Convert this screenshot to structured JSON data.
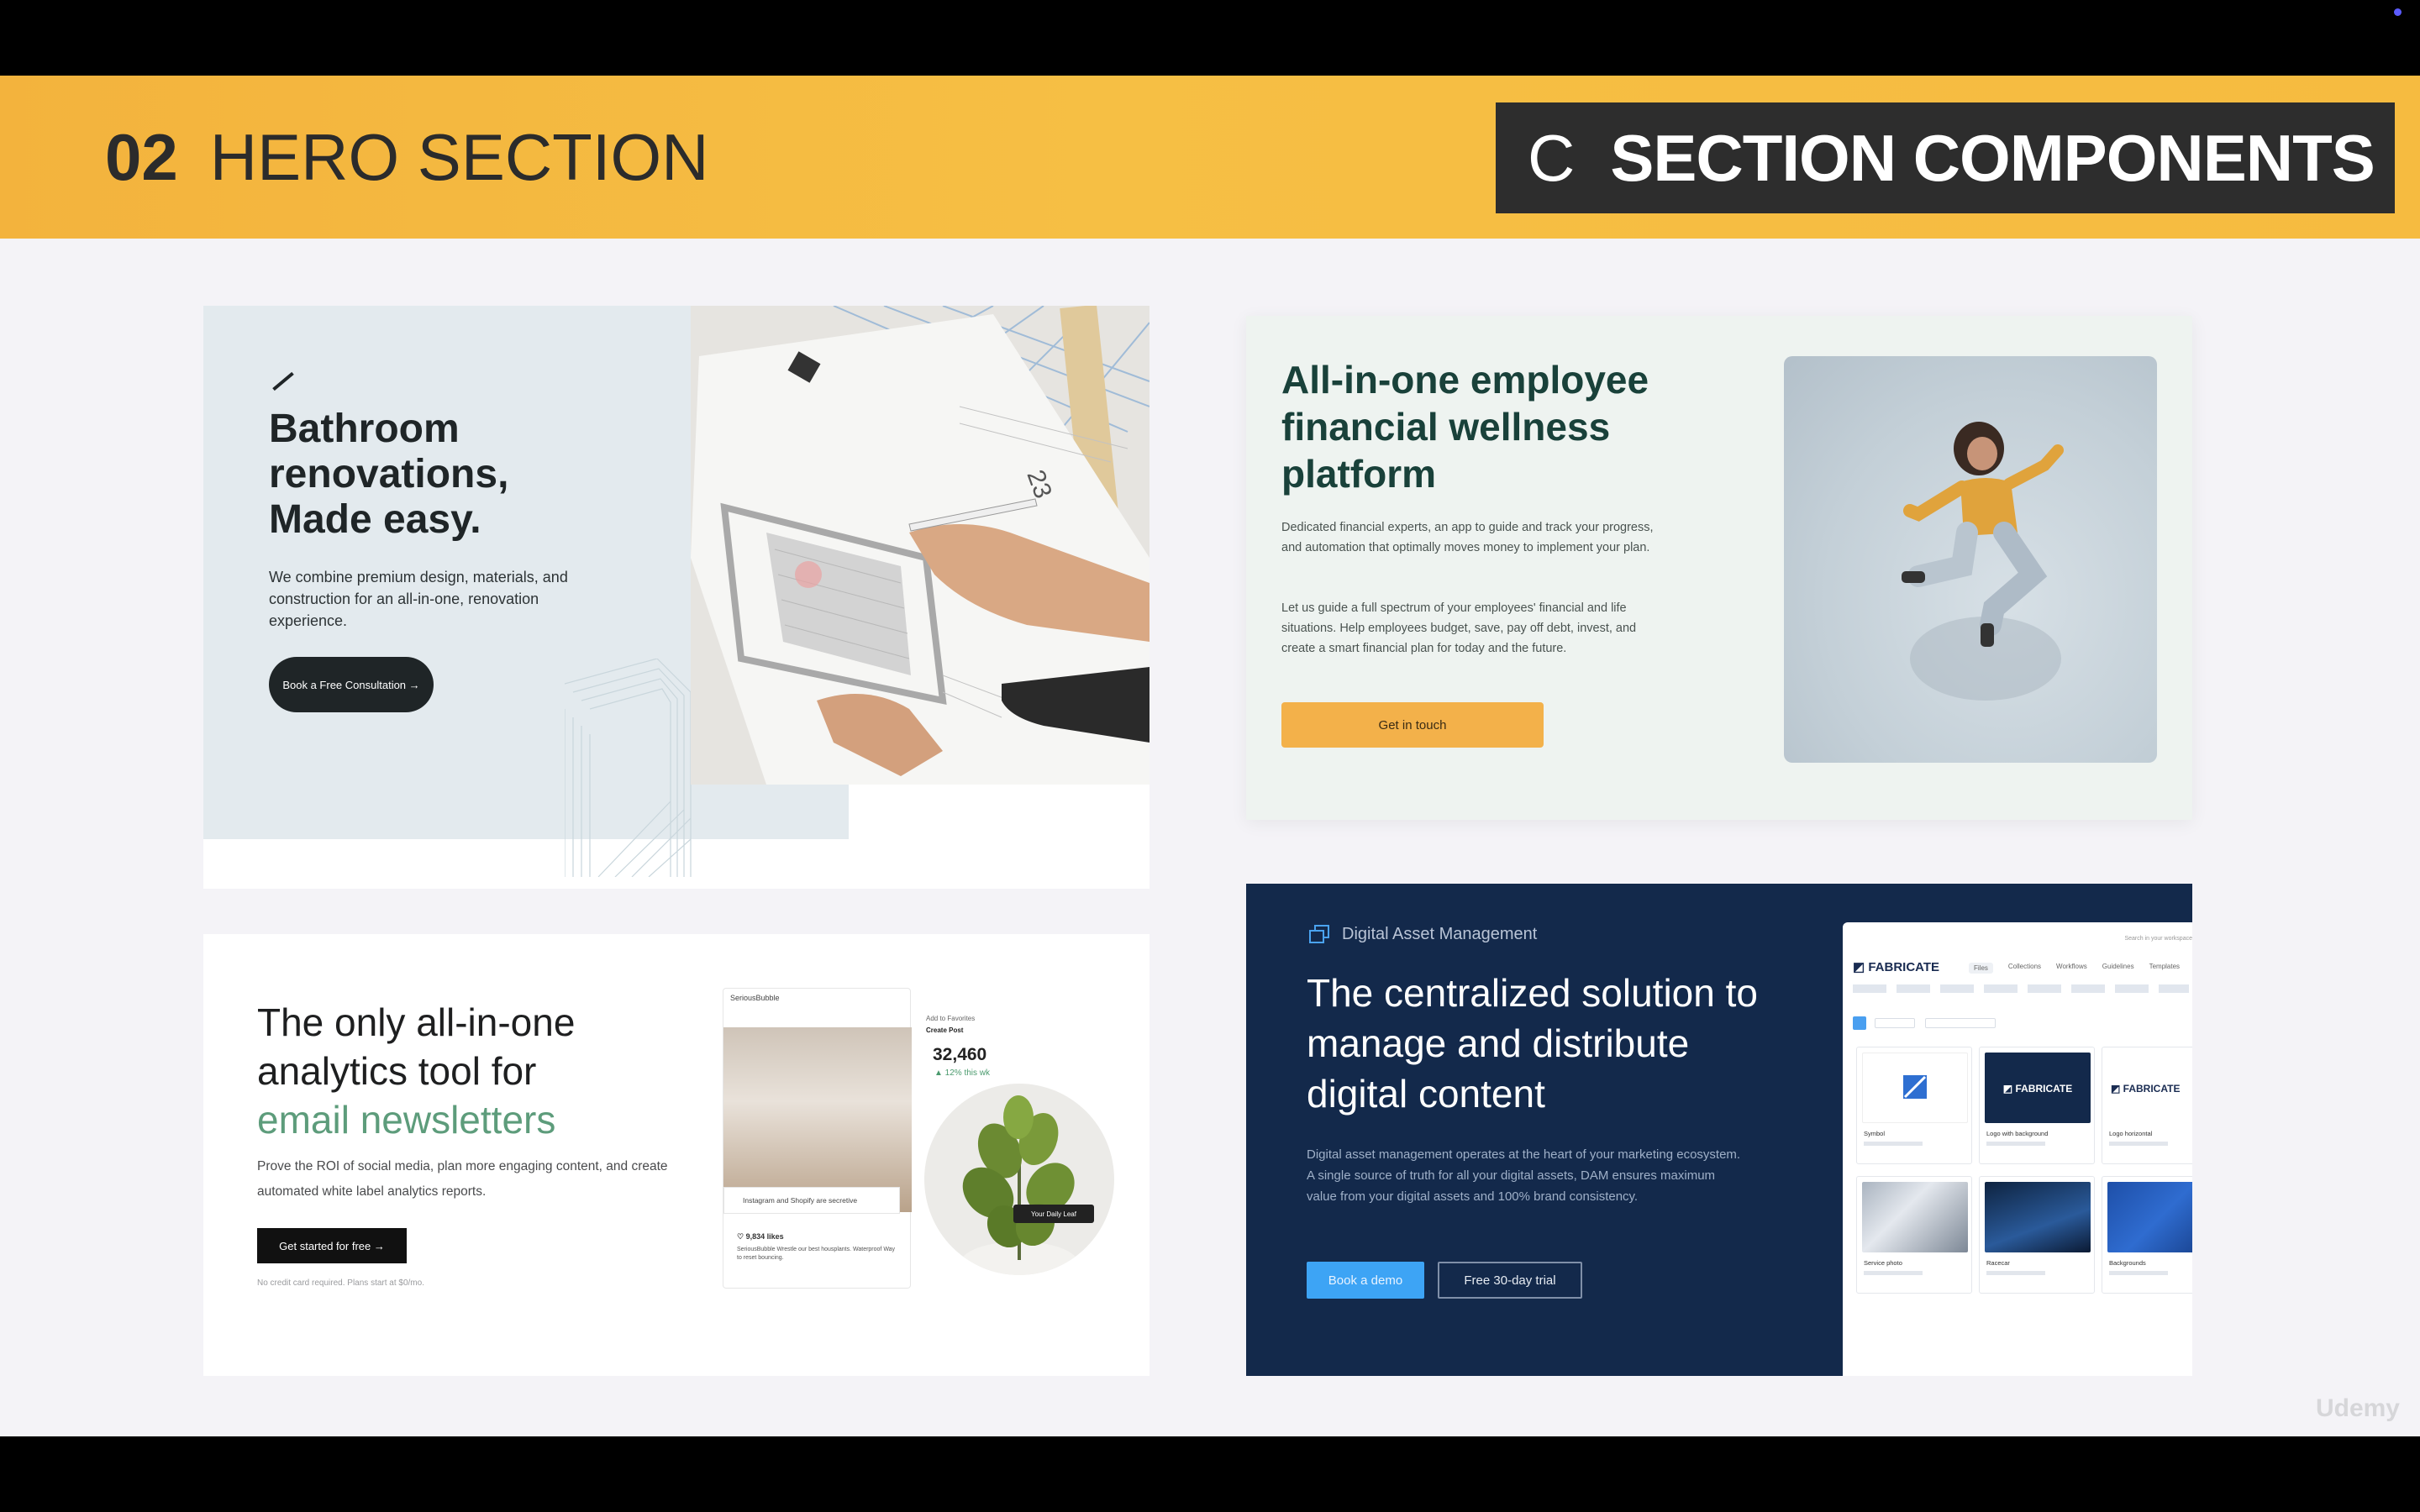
{
  "slide_header": {
    "section_number": "02",
    "section_title": "HERO SECTION",
    "chapter_letter": "C",
    "chapter_title": "SECTION COMPONENTS"
  },
  "watermark": "Udemy",
  "bathroom_card": {
    "title": "Bathroom renovations, Made easy.",
    "description": "We combine premium design, materials, and construction for an all-in-one, renovation experience.",
    "button": "Book a Free Consultation →"
  },
  "wellness_card": {
    "title": "All-in-one employee financial wellness platform",
    "description_1": "Dedicated financial experts, an app to guide and track your progress, and automation that optimally moves money to implement your plan.",
    "description_2": "Let us guide a full spectrum of your employees' financial and life situations. Help employees budget, save, pay off debt, invest, and create a smart financial plan for today and the future.",
    "button": "Get in touch",
    "accent_color": "#f3b14a"
  },
  "newsletter_card": {
    "title_line_1": "The only all-in-one",
    "title_line_2": "analytics tool for",
    "title_highlight": "email newsletters",
    "description": "Prove the ROI of social media, plan more engaging content, and create automated white label analytics reports.",
    "button": "Get started for free →",
    "note": "No credit card required. Plans start at $0/mo.",
    "mockup": {
      "account": "SeriousBubble",
      "tag": "Instagram and Shopify are secretive",
      "likes": "♡ 9,834 likes",
      "caption": "SeriousBubble Wrestle our best housplants. Waterproof Way to reset bouncing.",
      "stat_label": "Add to Favorites",
      "stat_sub": "Create Post",
      "count": "32,460",
      "growth": "▲ 12% this wk",
      "chip": "Your Daily Leaf"
    },
    "highlight_color": "#5d9c7b"
  },
  "dam_card": {
    "brand_label": "Digital Asset Management",
    "title": "The centralized solution to manage and distribute digital content",
    "description": "Digital asset management operates at the heart of your marketing ecosystem. A single source of truth for all your digital assets, DAM ensures maximum value from your digital assets and 100% brand consistency.",
    "primary_button": "Book a demo",
    "secondary_button": "Free 30-day trial",
    "background_color": "#13294b",
    "app": {
      "logo": "FABRICATE",
      "search_placeholder": "Search in your workspace",
      "tabs": [
        "Files",
        "Collections",
        "Workflows",
        "Guidelines",
        "Templates"
      ],
      "tiles": [
        {
          "name": "Symbol"
        },
        {
          "name": "Logo with background"
        },
        {
          "name": "Logo horizontal"
        },
        {
          "name": "Service photo"
        },
        {
          "name": "Racecar"
        },
        {
          "name": "Backgrounds"
        }
      ]
    }
  }
}
